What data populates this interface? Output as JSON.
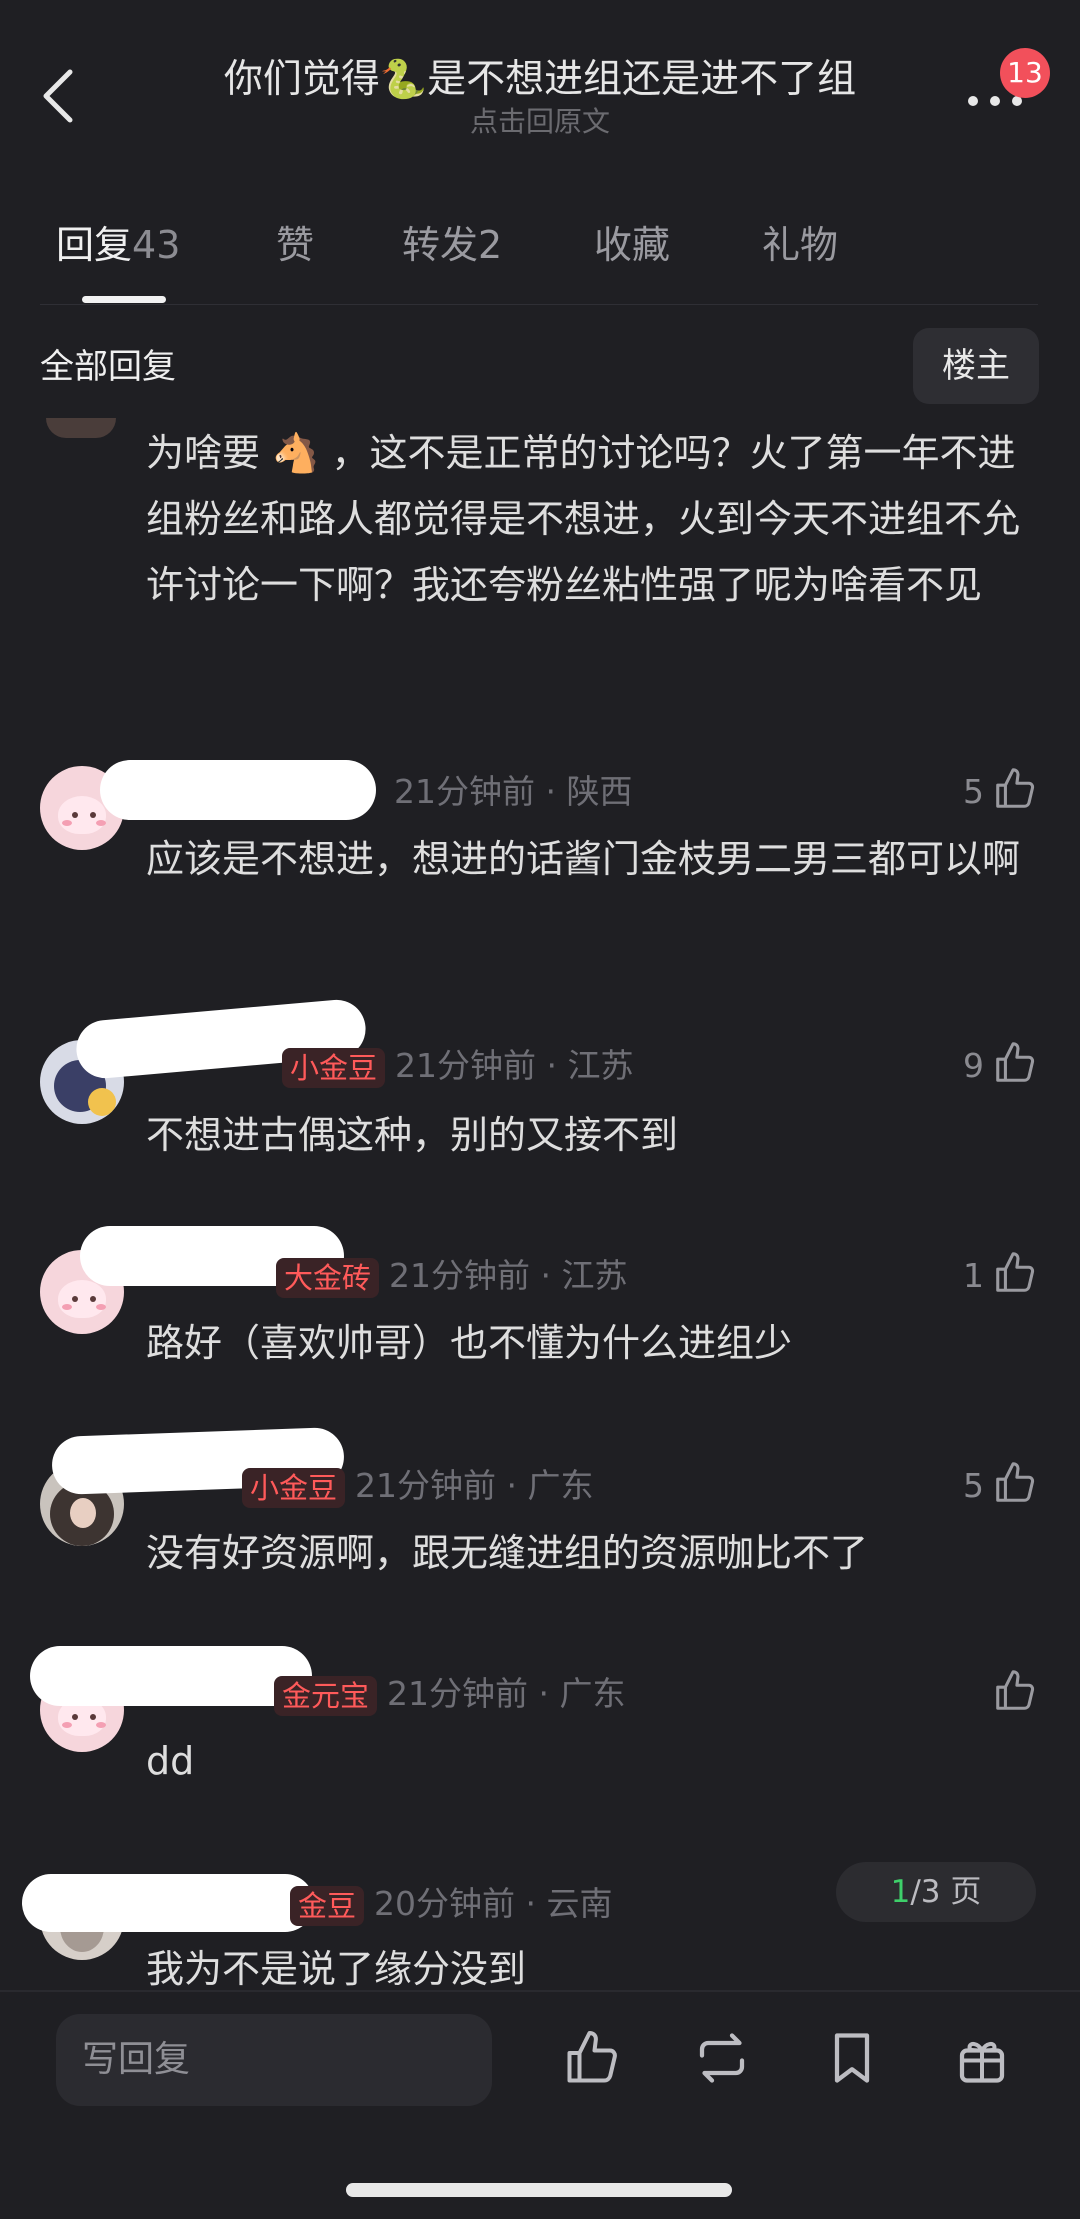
{
  "header": {
    "title_pre": "你们觉得",
    "title_emoji": "🐍",
    "title_post": "是不想进组还是进不了组",
    "subtitle": "点击回原文",
    "badge": "13"
  },
  "tabs": [
    {
      "label": "回复",
      "count": "43"
    },
    {
      "label": "赞",
      "count": ""
    },
    {
      "label": "转发",
      "count": "2"
    },
    {
      "label": "收藏",
      "count": ""
    },
    {
      "label": "礼物",
      "count": ""
    }
  ],
  "section": {
    "all_replies": "全部回复",
    "op_button": "楼主"
  },
  "comments": [
    {
      "text_pre": "为啥要",
      "emoji": "🐴",
      "text_post": "，这不是正常的讨论吗？火了第一年不进组粉丝和路人都觉得是不想进，火到今天不进组不允许讨论一下啊？我还夸粉丝粘性强了呢为啥看不见"
    },
    {
      "tag": "",
      "meta": "21分钟前 · 陕西",
      "likes": "5",
      "text": "应该是不想进，想进的话酱门金枝男二男三都可以啊"
    },
    {
      "tag": "小金豆",
      "meta": "21分钟前 · 江苏",
      "likes": "9",
      "text": "不想进古偶这种，别的又接不到"
    },
    {
      "tag": "大金砖",
      "meta": "21分钟前 · 江苏",
      "likes": "1",
      "text": "路好（喜欢帅哥）也不懂为什么进组少"
    },
    {
      "tag": "小金豆",
      "meta": "21分钟前 · 广东",
      "likes": "5",
      "text": "没有好资源啊，跟无缝进组的资源咖比不了"
    },
    {
      "tag": "金元宝",
      "meta": "21分钟前 · 广东",
      "likes": "",
      "text": "dd"
    },
    {
      "tag": "金豆",
      "meta": "20分钟前 · 云南",
      "likes": "",
      "text": "我为不是说了缘分没到"
    }
  ],
  "pager": {
    "current": "1",
    "total": "/3 页"
  },
  "bottom": {
    "reply_placeholder": "写回复"
  },
  "colors": {
    "background": "#1f1f23",
    "badge": "#f2505b",
    "tag": "#ff5a5a",
    "pager_current": "#3ecf6a"
  },
  "icons": [
    "back-icon",
    "more-icon",
    "thumb-up-icon",
    "repost-icon",
    "bookmark-icon",
    "gift-icon"
  ]
}
